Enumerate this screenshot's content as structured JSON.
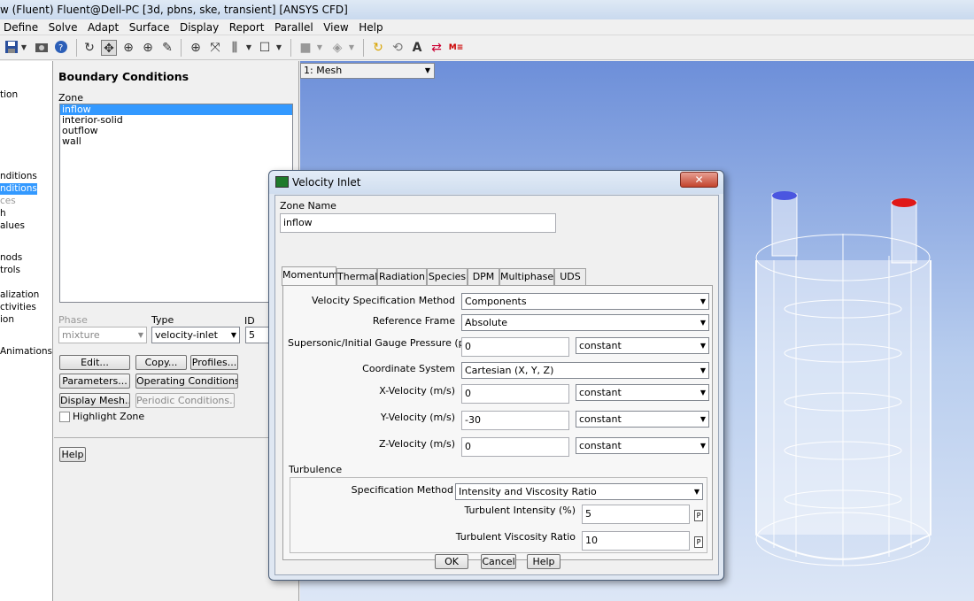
{
  "window": {
    "title": "w (Fluent) Fluent@Dell-PC  [3d, pbns, ske, transient] [ANSYS CFD]"
  },
  "menubar": [
    "Define",
    "Solve",
    "Adapt",
    "Surface",
    "Display",
    "Report",
    "Parallel",
    "View",
    "Help"
  ],
  "toolbar": {
    "icons": [
      "save-icon",
      "dropdown-icon",
      "camera-icon",
      "help-icon",
      "rotate-icon",
      "pan-icon",
      "zoom-icon",
      "zoom-box-icon",
      "probe-icon",
      "zoom-fit-icon",
      "measure-icon",
      "view-icon",
      "box-icon",
      "render-icon",
      "light-icon",
      "refresh-icon",
      "annotate-icon",
      "transform-icon",
      "mesh-icon"
    ]
  },
  "left_tree": {
    "items": [
      {
        "label": "tion",
        "selected": false
      },
      {
        "label": "nditions",
        "selected": false
      },
      {
        "label": "nditions",
        "selected": true
      },
      {
        "label": "ces",
        "selected": false
      },
      {
        "label": "h",
        "selected": false
      },
      {
        "label": "alues",
        "selected": false
      },
      {
        "label": "nods",
        "selected": false
      },
      {
        "label": "trols",
        "selected": false
      },
      {
        "label": "alization",
        "selected": false
      },
      {
        "label": "ctivities",
        "selected": false
      },
      {
        "label": "ion",
        "selected": false
      },
      {
        "label": "Animations",
        "selected": false
      }
    ]
  },
  "bc_panel": {
    "title": "Boundary Conditions",
    "zone_label": "Zone",
    "zones": [
      {
        "label": "inflow",
        "selected": true
      },
      {
        "label": "interior-solid",
        "selected": false
      },
      {
        "label": "outflow",
        "selected": false
      },
      {
        "label": "wall",
        "selected": false
      }
    ],
    "phase_label": "Phase",
    "phase_value": "mixture",
    "type_label": "Type",
    "type_value": "velocity-inlet",
    "id_label": "ID",
    "id_value": "5",
    "buttons": {
      "edit": "Edit...",
      "copy": "Copy...",
      "profiles": "Profiles...",
      "parameters": "Parameters...",
      "operating": "Operating Conditions...",
      "display_mesh": "Display Mesh...",
      "periodic": "Periodic Conditions...",
      "help": "Help"
    },
    "highlight_zone": "Highlight Zone"
  },
  "viewport": {
    "window_select": "1: Mesh"
  },
  "dialog": {
    "title": "Velocity Inlet",
    "close": "✕",
    "zone_name_label": "Zone Name",
    "zone_name_value": "inflow",
    "tabs": [
      "Momentum",
      "Thermal",
      "Radiation",
      "Species",
      "DPM",
      "Multiphase",
      "UDS"
    ],
    "active_tab": "Momentum",
    "momentum": {
      "vel_spec_label": "Velocity Specification Method",
      "vel_spec_value": "Components",
      "ref_frame_label": "Reference Frame",
      "ref_frame_value": "Absolute",
      "pressure_label": "Supersonic/Initial Gauge Pressure (pascal)",
      "pressure_value": "0",
      "pressure_mode": "constant",
      "coord_label": "Coordinate System",
      "coord_value": "Cartesian (X, Y, Z)",
      "xvel_label": "X-Velocity (m/s)",
      "xvel_value": "0",
      "xvel_mode": "constant",
      "yvel_label": "Y-Velocity (m/s)",
      "yvel_value": "-30",
      "yvel_mode": "constant",
      "zvel_label": "Z-Velocity (m/s)",
      "zvel_value": "0",
      "zvel_mode": "constant"
    },
    "turbulence": {
      "label": "Turbulence",
      "spec_label": "Specification Method",
      "spec_value": "Intensity and Viscosity Ratio",
      "intensity_label": "Turbulent Intensity (%)",
      "intensity_value": "5",
      "viscosity_label": "Turbulent Viscosity Ratio",
      "viscosity_value": "10",
      "p_label": "P"
    },
    "buttons": {
      "ok": "OK",
      "cancel": "Cancel",
      "help": "Help"
    }
  }
}
